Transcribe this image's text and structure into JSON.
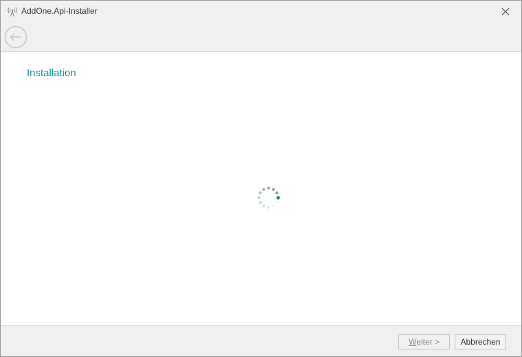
{
  "window": {
    "title": "AddOne.Api-Installer",
    "app_icon": "antenna-icon",
    "close_icon": "close-icon"
  },
  "toolbar": {
    "back_icon": "back-arrow-icon"
  },
  "content": {
    "page_title": "Installation",
    "loading_indicator": "spinner-icon"
  },
  "footer": {
    "next_mnemonic": "W",
    "next_rest": "eiter >",
    "next_enabled": false,
    "cancel_label": "Abbrechen"
  },
  "colors": {
    "accent": "#19959a",
    "chrome_bg": "#f0f0f0",
    "disabled_text": "#8d8d8d"
  }
}
